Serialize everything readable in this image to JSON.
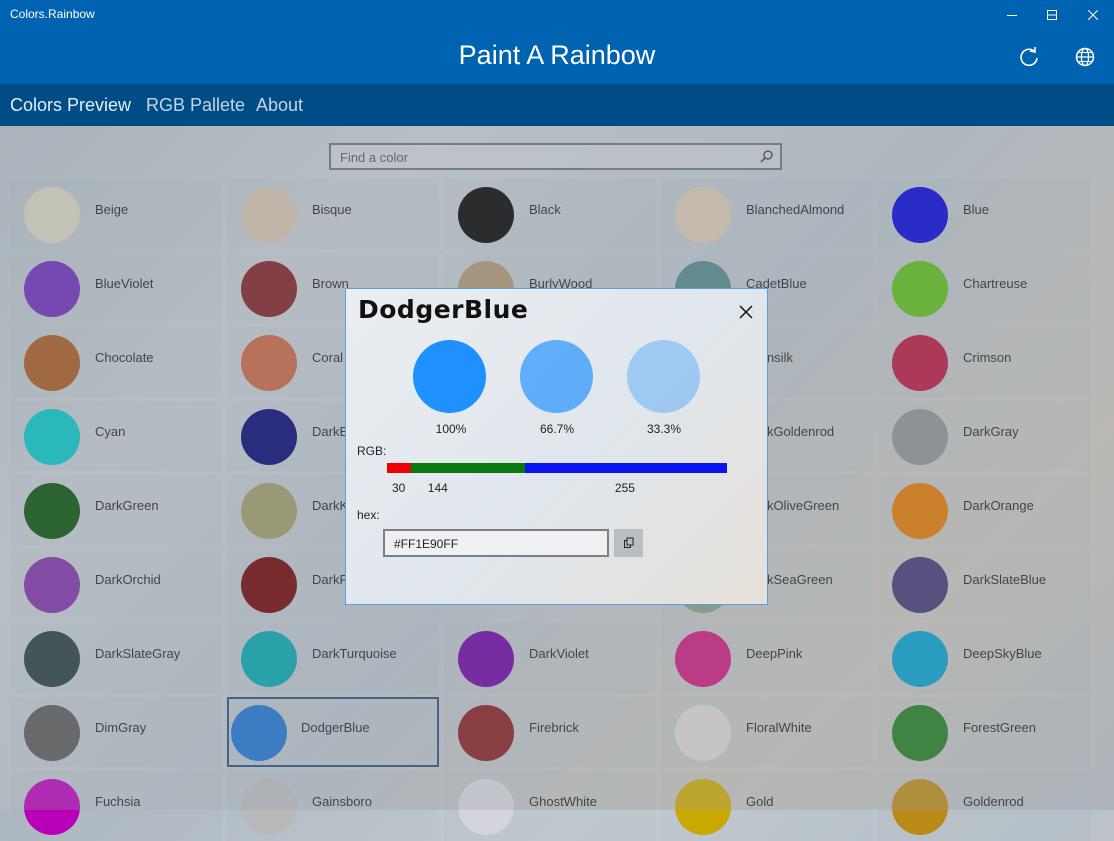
{
  "window": {
    "title": "Colors.Rainbow"
  },
  "header": {
    "title": "Paint A Rainbow",
    "refresh_icon": "refresh-icon",
    "globe_icon": "globe-icon"
  },
  "nav": {
    "tabs": [
      {
        "label": "Colors Preview",
        "active": true
      },
      {
        "label": "RGB Pallete",
        "active": false
      },
      {
        "label": "About",
        "active": false
      }
    ]
  },
  "search": {
    "placeholder": "Find a color",
    "icon": "search-icon"
  },
  "colors": [
    {
      "name": "Beige",
      "hex": "#d3d0bd"
    },
    {
      "name": "Bisque",
      "hex": "#d3c0ac"
    },
    {
      "name": "Black",
      "hex": "#000000"
    },
    {
      "name": "BlanchedAlmond",
      "hex": "#d6c7b0"
    },
    {
      "name": "Blue",
      "hex": "#0000d8"
    },
    {
      "name": "BlueViolet",
      "hex": "#6a28b8"
    },
    {
      "name": "Brown",
      "hex": "#7a1d1f"
    },
    {
      "name": "BurlyWood",
      "hex": "#ad9471"
    },
    {
      "name": "CadetBlue",
      "hex": "#4f8385"
    },
    {
      "name": "Chartreuse",
      "hex": "#5aba14"
    },
    {
      "name": "Chocolate",
      "hex": "#a4551b"
    },
    {
      "name": "Coral",
      "hex": "#c5603d"
    },
    {
      "name": "Cornsilk",
      "hex": "#d8d2b6"
    },
    {
      "name": "Crimson",
      "hex": "#b4133a"
    },
    {
      "name": "Cyan",
      "hex": "#00c2c2"
    },
    {
      "name": "DarkBlue",
      "hex": "#00006f"
    },
    {
      "name": "DarkGoldenrod",
      "hex": "#a27d12"
    },
    {
      "name": "DarkGray",
      "hex": "#8b8f93"
    },
    {
      "name": "DarkGreen",
      "hex": "#024d05"
    },
    {
      "name": "DarkKhaki",
      "hex": "#9c9866"
    },
    {
      "name": "DarkOliveGreen",
      "hex": "#4f5f30"
    },
    {
      "name": "DarkOrange",
      "hex": "#df7500"
    },
    {
      "name": "DarkOrchid",
      "hex": "#7b2ba4"
    },
    {
      "name": "DarkRed",
      "hex": "#6d0000"
    },
    {
      "name": "DarkSeaGreen",
      "hex": "#7d9f7e"
    },
    {
      "name": "DarkSlateBlue",
      "hex": "#3e3470"
    },
    {
      "name": "DarkSlateGray",
      "hex": "#24393b"
    },
    {
      "name": "DarkTurquoise",
      "hex": "#00a3a7"
    },
    {
      "name": "DarkViolet",
      "hex": "#6c00a0"
    },
    {
      "name": "DeepPink",
      "hex": "#c8157b"
    },
    {
      "name": "DeepSkyBlue",
      "hex": "#009ccb"
    },
    {
      "name": "DimGray",
      "hex": "#555555"
    },
    {
      "name": "DodgerBlue",
      "hex": "#1a6fcd"
    },
    {
      "name": "Firebrick",
      "hex": "#841b1b"
    },
    {
      "name": "FloralWhite",
      "hex": "#d9d5d0"
    },
    {
      "name": "ForestGreen",
      "hex": "#1e7a1e"
    },
    {
      "name": "Fuchsia",
      "hex": "#b800b8"
    },
    {
      "name": "Gainsboro",
      "hex": "#b7b9bb"
    },
    {
      "name": "GhostWhite",
      "hex": "#d3d4dc"
    },
    {
      "name": "Gold",
      "hex": "#c9a800"
    },
    {
      "name": "Goldenrod",
      "hex": "#b98a17"
    }
  ],
  "dialog": {
    "title": "DodgerBlue",
    "close_icon": "close-icon",
    "color": "#1e90ff",
    "opacities": [
      {
        "label": "100%",
        "value": 1.0
      },
      {
        "label": "66.7%",
        "value": 0.667
      },
      {
        "label": "33.3%",
        "value": 0.333
      }
    ],
    "rgb_label": "RGB:",
    "rgb": {
      "r": 30,
      "g": 144,
      "b": 255
    },
    "rgb_text": {
      "r": "30",
      "g": "144",
      "b": "255"
    },
    "rgb_colors": {
      "r": "#ee0000",
      "g": "#0a7a10",
      "b": "#0a14ee"
    },
    "hex_label": "hex:",
    "hex_value": "#FF1E90FF",
    "copy_icon": "copy-icon"
  }
}
